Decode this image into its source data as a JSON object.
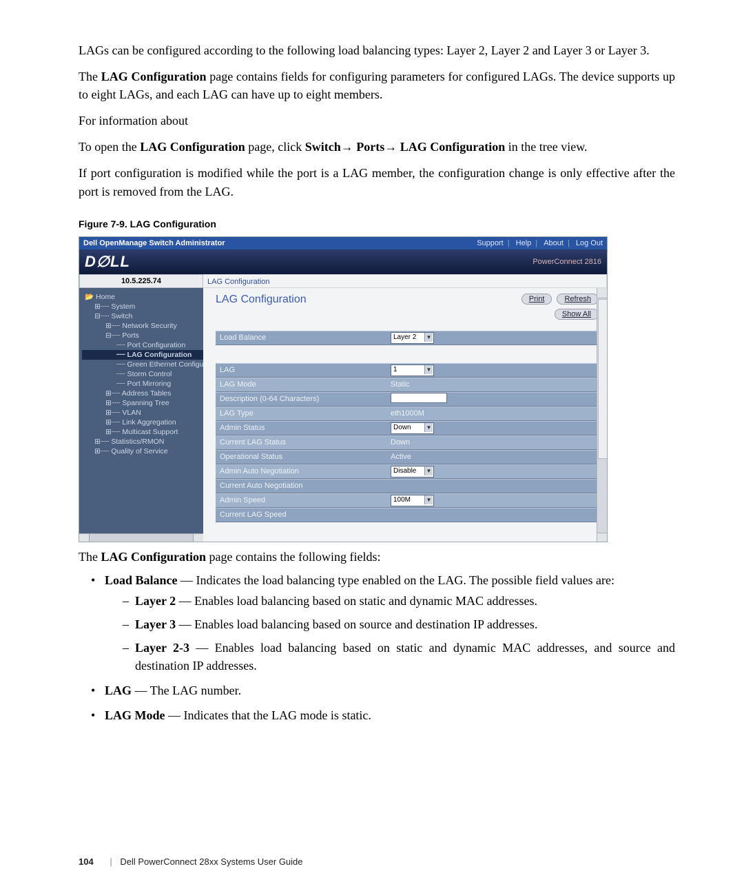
{
  "intro": {
    "p1": "LAGs can be configured according to the following load balancing types: Layer 2, Layer 2 and Layer 3 or Layer 3.",
    "p2a": "The ",
    "p2b": "LAG Configuration",
    "p2c": " page contains fields for configuring parameters for configured LAGs. The device supports up to eight LAGs, and each LAG can have up to eight members.",
    "p3": "For information about",
    "p4a": "To open the ",
    "p4b": "LAG Configuration",
    "p4c": " page, click ",
    "p4d": "Switch",
    "p4e": "→ ",
    "p4f": "Ports",
    "p4g": "→ ",
    "p4h": "LAG Configuration",
    "p4i": " in the tree view.",
    "p5": "If port configuration is modified while the port is a LAG member, the configuration change is only effective after the port is removed from the LAG."
  },
  "figcap": "Figure 7-9.    LAG Configuration",
  "ss": {
    "title": "Dell OpenManage Switch Administrator",
    "menu": {
      "support": "Support",
      "help": "Help",
      "about": "About",
      "logout": "Log Out"
    },
    "brand": "D∅LL",
    "model": "PowerConnect 2816",
    "ip": "10.5.225.74",
    "breadcrumb": "LAG Configuration",
    "tree": [
      {
        "t": "Home",
        "d": 0
      },
      {
        "t": "System",
        "d": 1,
        "pre": "⊞┈┈"
      },
      {
        "t": "Switch",
        "d": 1,
        "pre": "⊟┈┈"
      },
      {
        "t": "Network Security",
        "d": 2,
        "pre": "⊞┈┈"
      },
      {
        "t": "Ports",
        "d": 2,
        "pre": "⊟┈┈"
      },
      {
        "t": "Port Configuration",
        "d": 3,
        "pre": "┈┈"
      },
      {
        "t": "LAG Configuration",
        "d": 3,
        "pre": "┈┈",
        "sel": true
      },
      {
        "t": "Green Ethernet Configurati",
        "d": 3,
        "pre": "┈┈"
      },
      {
        "t": "Storm Control",
        "d": 3,
        "pre": "┈┈"
      },
      {
        "t": "Port Mirroring",
        "d": 3,
        "pre": "┈┈"
      },
      {
        "t": "Address Tables",
        "d": 2,
        "pre": "⊞┈┈"
      },
      {
        "t": "Spanning Tree",
        "d": 2,
        "pre": "⊞┈┈"
      },
      {
        "t": "VLAN",
        "d": 2,
        "pre": "⊞┈┈"
      },
      {
        "t": "Link Aggregation",
        "d": 2,
        "pre": "⊞┈┈"
      },
      {
        "t": "Multicast Support",
        "d": 2,
        "pre": "⊞┈┈"
      },
      {
        "t": "Statistics/RMON",
        "d": 1,
        "pre": "⊞┈┈"
      },
      {
        "t": "Quality of Service",
        "d": 1,
        "pre": "⊞┈┈"
      }
    ],
    "content_title": "LAG Configuration",
    "btns": {
      "print": "Print",
      "refresh": "Refresh",
      "showall": "Show All"
    },
    "rows1": [
      {
        "label": "Load Balance",
        "type": "select",
        "value": "Layer 2"
      }
    ],
    "rows2": [
      {
        "label": "LAG",
        "type": "select",
        "value": "1"
      },
      {
        "label": "LAG Mode",
        "type": "text",
        "value": "Static"
      },
      {
        "label": "Description (0-64 Characters)",
        "type": "input",
        "value": ""
      },
      {
        "label": "LAG Type",
        "type": "text",
        "value": "eth1000M"
      },
      {
        "label": "Admin Status",
        "type": "select",
        "value": "Down"
      },
      {
        "label": "Current LAG Status",
        "type": "text",
        "value": "Down"
      },
      {
        "label": "Operational Status",
        "type": "text",
        "value": "Active"
      },
      {
        "label": "Admin Auto Negotiation",
        "type": "select",
        "value": "Disable"
      },
      {
        "label": "Current Auto Negotiation",
        "type": "text",
        "value": ""
      },
      {
        "label": "Admin Speed",
        "type": "select",
        "value": "100M"
      },
      {
        "label": "Current LAG Speed",
        "type": "text",
        "value": ""
      }
    ]
  },
  "desc": {
    "intro_a": "The ",
    "intro_b": "LAG Configuration",
    "intro_c": " page contains the following fields:",
    "items": [
      {
        "term": "Load Balance",
        "text": " — Indicates the load balancing type enabled on the LAG. The possible field values are:",
        "subs": [
          {
            "term": "Layer 2",
            "text": " — Enables load balancing based on static and dynamic MAC addresses."
          },
          {
            "term": "Layer 3",
            "text": " — Enables load balancing based on source and destination IP addresses."
          },
          {
            "term": "Layer 2-3",
            "text": " — Enables load balancing based on static and dynamic MAC addresses, and source and destination IP addresses."
          }
        ]
      },
      {
        "term": "LAG",
        "text": " — The LAG number."
      },
      {
        "term": "LAG Mode",
        "text": " — Indicates that the LAG mode is static."
      }
    ]
  },
  "footer": {
    "page": "104",
    "title": "Dell PowerConnect 28xx Systems User Guide"
  }
}
